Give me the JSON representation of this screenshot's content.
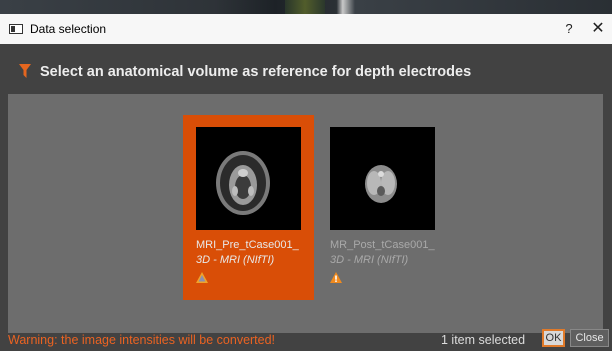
{
  "window": {
    "title": "Data selection",
    "help_label": "?",
    "close_label": "✕"
  },
  "header": {
    "text": "Select an anatomical volume as reference for depth electrodes",
    "accent": "#e5661f"
  },
  "items": [
    {
      "name": "MRI_Pre_tCase001_",
      "type": "3D - MRI (NIfTI)",
      "selected": true,
      "icon": "warning-icon"
    },
    {
      "name": "MR_Post_tCase001_",
      "type": "3D - MRI (NIfTI)",
      "selected": false,
      "icon": "warning-icon"
    }
  ],
  "footer": {
    "warning": "Warning: the image intensities will be converted!",
    "selection_count": "1 item selected",
    "ok_label": "OK",
    "close_label": "Close"
  },
  "colors": {
    "selected": "#d94e07",
    "panel": "#6d6d6d",
    "dialog": "#424242",
    "warning_text": "#ea6322"
  }
}
